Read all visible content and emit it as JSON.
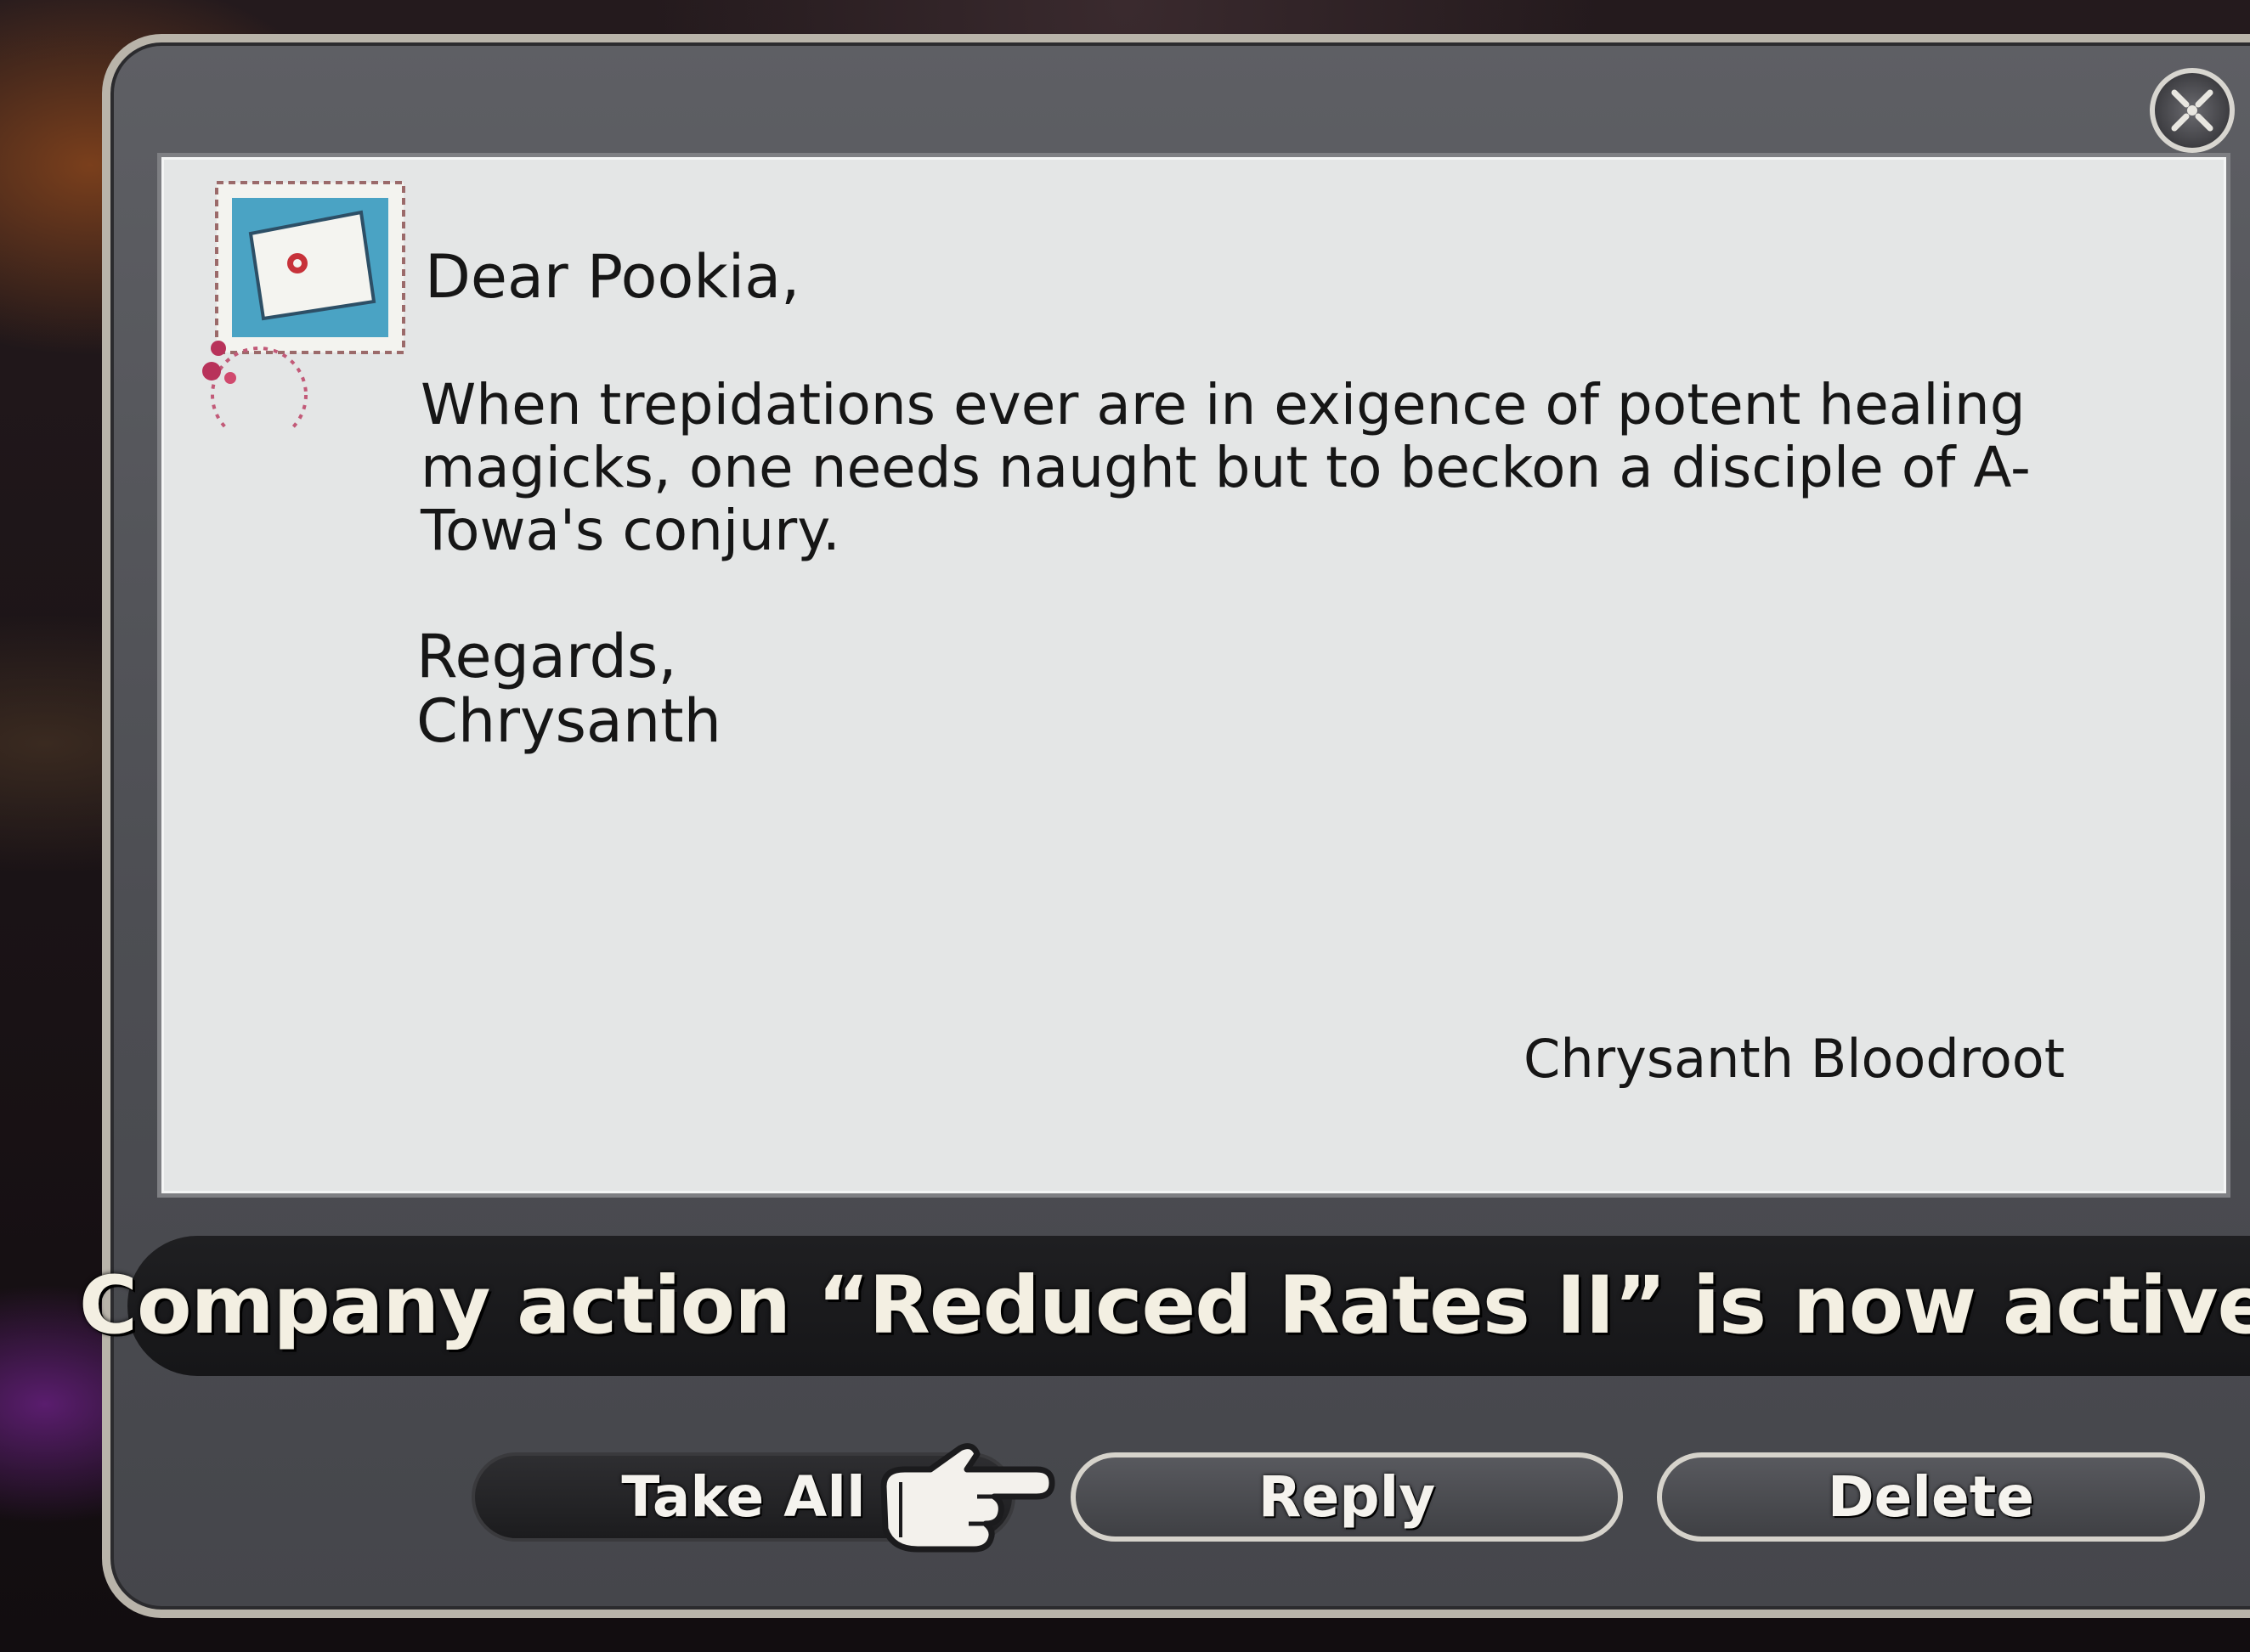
{
  "letter": {
    "greeting": "Dear Pookia,",
    "body": "When trepidations ever are in exigence of potent healing magicks, one needs naught but to beckon a disciple of A-Towa's conjury.",
    "closing": "Regards,",
    "signature": "Chrysanth",
    "sender": "Chrysanth Bloodroot"
  },
  "notification": {
    "text": "Company action “Reduced Rates II” is now active."
  },
  "actions": {
    "take_all_label": "Take All",
    "reply_label": "Reply",
    "delete_label": "Delete"
  },
  "icons": {
    "close": "close-icon",
    "stamp": "letter-stamp-icon",
    "cursor": "pointing-hand-cursor-icon"
  },
  "colors": {
    "paper": "#e4e6e6",
    "window_frame": "#5e5f64",
    "banner_text": "#f3efe2"
  }
}
